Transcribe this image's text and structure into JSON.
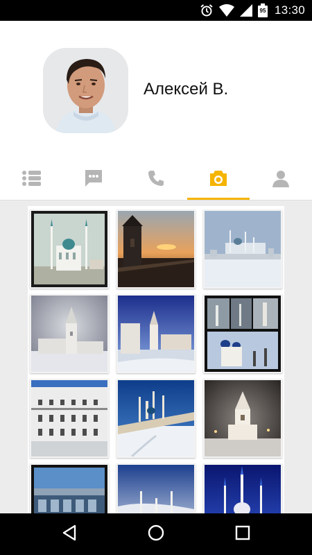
{
  "status_bar": {
    "time": "13:30",
    "battery_level": "95"
  },
  "profile": {
    "name": "Алексей В."
  },
  "tabs": [
    {
      "icon": "list-icon",
      "active": false
    },
    {
      "icon": "chat-icon",
      "active": false
    },
    {
      "icon": "phone-icon",
      "active": false
    },
    {
      "icon": "camera-icon",
      "active": true
    },
    {
      "icon": "person-icon",
      "active": false
    }
  ],
  "colors": {
    "accent": "#f5b400",
    "inactive_icon": "#b5b5b5",
    "grid_background": "#ececec"
  },
  "photos": [
    {
      "subject": "mosque-white"
    },
    {
      "subject": "tower-sunset"
    },
    {
      "subject": "kremlin-winter-wide"
    },
    {
      "subject": "tower-snow-cloudy"
    },
    {
      "subject": "kremlin-blue-sky"
    },
    {
      "subject": "collage"
    },
    {
      "subject": "building-facade"
    },
    {
      "subject": "kremlin-wall-snow"
    },
    {
      "subject": "tower-night-snow"
    },
    {
      "subject": "station-building"
    },
    {
      "subject": "mosque-dome-blue"
    },
    {
      "subject": "mosque-night-lit"
    }
  ],
  "nav": [
    {
      "icon": "back-icon"
    },
    {
      "icon": "home-icon"
    },
    {
      "icon": "recents-icon"
    }
  ]
}
